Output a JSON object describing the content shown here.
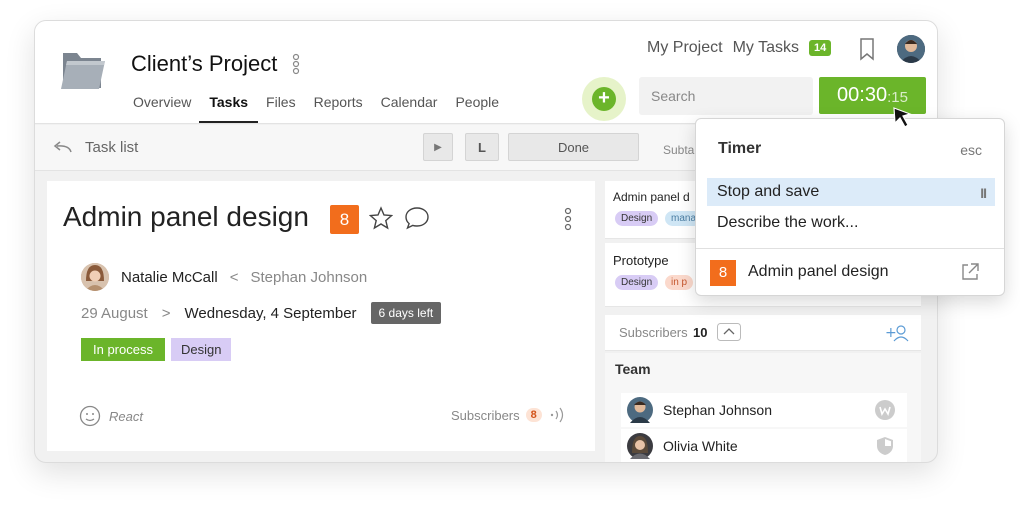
{
  "header": {
    "title": "Client’s Project",
    "tabs": [
      {
        "label": "Overview",
        "active": false
      },
      {
        "label": "Tasks",
        "active": true
      },
      {
        "label": "Files",
        "active": false
      },
      {
        "label": "Reports",
        "active": false
      },
      {
        "label": "Calendar",
        "active": false
      },
      {
        "label": "People",
        "active": false
      }
    ],
    "my_project": "My Project",
    "my_tasks": "My Tasks",
    "my_tasks_count": "14",
    "search_placeholder": "Search",
    "timer_main": "00:30",
    "timer_sec": ":15",
    "accent": "#6bb52a"
  },
  "subbar": {
    "label": "Task list",
    "done_label": "Done",
    "subtasks_label": "Subta",
    "play_glyph": "▶",
    "l_glyph": "L"
  },
  "task": {
    "title": "Admin panel design",
    "number": "8",
    "assignee": "Natalie McCall",
    "separator_lt": "<",
    "assigner": "Stephan Johnson",
    "start_date": "29 August",
    "separator_gt": ">",
    "due_date": "Wednesday, 4 September",
    "days_left": "6 days left",
    "tags": [
      "In process",
      "Design"
    ],
    "react_label": "React",
    "subscribers_label": "Subscribers",
    "subscribers_count": "8"
  },
  "right": {
    "cards": [
      {
        "name": "Admin panel d",
        "tags": [
          "Design",
          "mana"
        ]
      },
      {
        "name": "Prototype",
        "tags": [
          "Design",
          "in p"
        ]
      }
    ],
    "subscribers_label": "Subscribers",
    "subscribers_count": "10",
    "team_title": "Team",
    "members": [
      {
        "name": "Stephan Johnson"
      },
      {
        "name": "Olivia White"
      }
    ]
  },
  "popup": {
    "title": "Timer",
    "esc": "esc",
    "stop_save": "Stop and save",
    "pause_glyph": "II",
    "describe": "Describe the work...",
    "task_number": "8",
    "task_name": "Admin panel design"
  }
}
